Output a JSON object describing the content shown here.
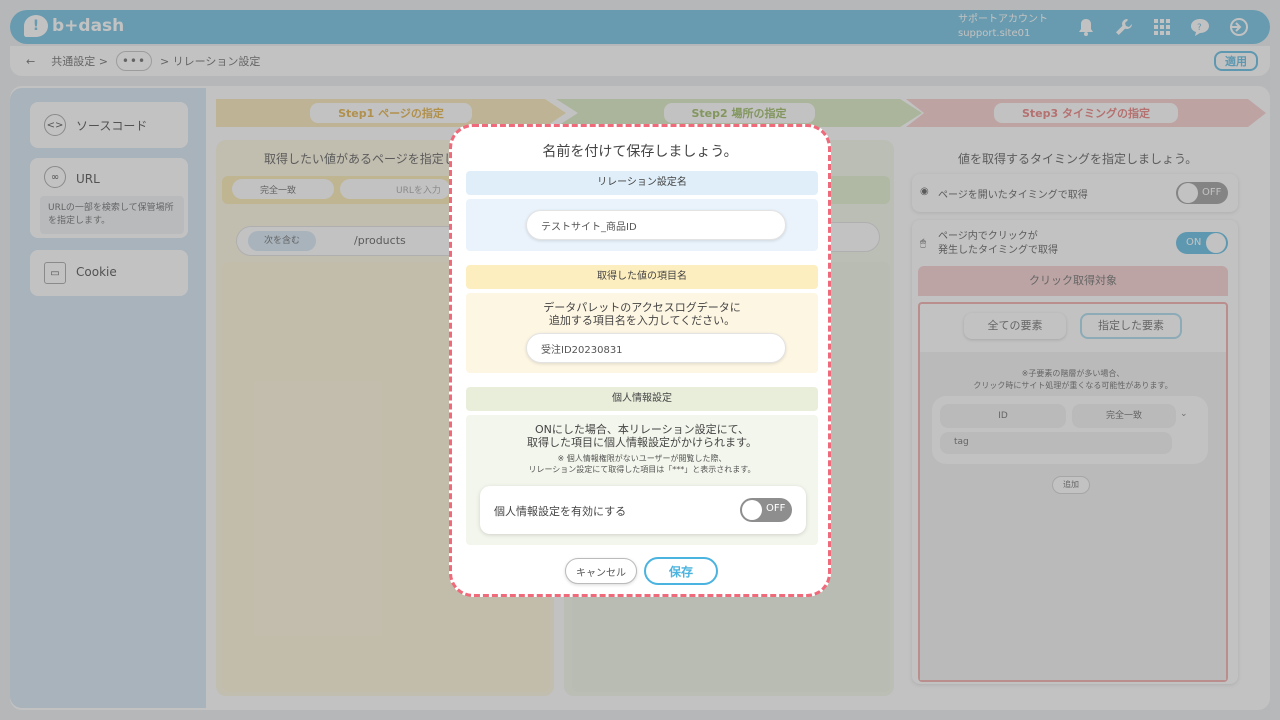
{
  "header": {
    "logo_badge": "!",
    "logo_text": "b+dash",
    "account_label": "サポートアカウント",
    "account_site": "support.site01",
    "icons": [
      "bell-icon",
      "wrench-icon",
      "grid-icon",
      "help-chat-icon",
      "logout-icon"
    ]
  },
  "breadcrumb": {
    "back": "←",
    "item1": "共通設定 >",
    "more": "•••",
    "current": "> リレーション設定",
    "apply": "適用"
  },
  "sidebar": {
    "source_code": "ソースコード",
    "url": "URL",
    "url_desc": "URLの一部を検索して保管場所を指定します。",
    "cookie": "Cookie"
  },
  "steps": {
    "step1": "Step1 ページの指定",
    "step2": "Step2 場所の指定",
    "step3": "Step3 タイミングの指定"
  },
  "step1_panel": {
    "title": "取得したい値があるページを指定し",
    "match_select": "完全一致",
    "url_placeholder": "URLを入力",
    "condition": "次を含む",
    "path": "/products"
  },
  "step3_panel": {
    "title": "値を取得するタイミングを指定しましょう。",
    "open_timing": "ページを開いたタイミングで取得",
    "open_toggle": "OFF",
    "click_timing_line1": "ページ内でクリックが",
    "click_timing_line2": "発生したタイミングで取得",
    "click_toggle": "ON",
    "click_target": "クリック取得対象",
    "all_elements": "全ての要素",
    "specified_elements": "指定した要素",
    "note_line1": "※子要素の階層が多い場合、",
    "note_line2": "クリック時にサイト処理が重くなる可能性があります。",
    "selector_type": "ID",
    "selector_match": "完全一致",
    "selector_value": "tag",
    "add": "追加"
  },
  "modal": {
    "title": "名前を付けて保存しましょう。",
    "relation_head": "リレーション設定名",
    "relation_value": "テストサイト_商品ID",
    "item_head": "取得した値の項目名",
    "item_desc_line1": "データパレットのアクセスログデータに",
    "item_desc_line2": "追加する項目名を入力してください。",
    "item_value": "受注ID20230831",
    "privacy_head": "個人情報設定",
    "privacy_desc_line1": "ONにした場合、本リレーション設定にて、",
    "privacy_desc_line2": "取得した項目に個人情報設定がかけられます。",
    "privacy_note_line1": "※ 個人情報権限がないユーザーが閲覧した際、",
    "privacy_note_line2": "リレーション設定にて取得した項目は「***」と表示されます。",
    "privacy_toggle_label": "個人情報設定を有効にする",
    "privacy_toggle_value": "OFF",
    "cancel": "キャンセル",
    "save": "保存"
  }
}
